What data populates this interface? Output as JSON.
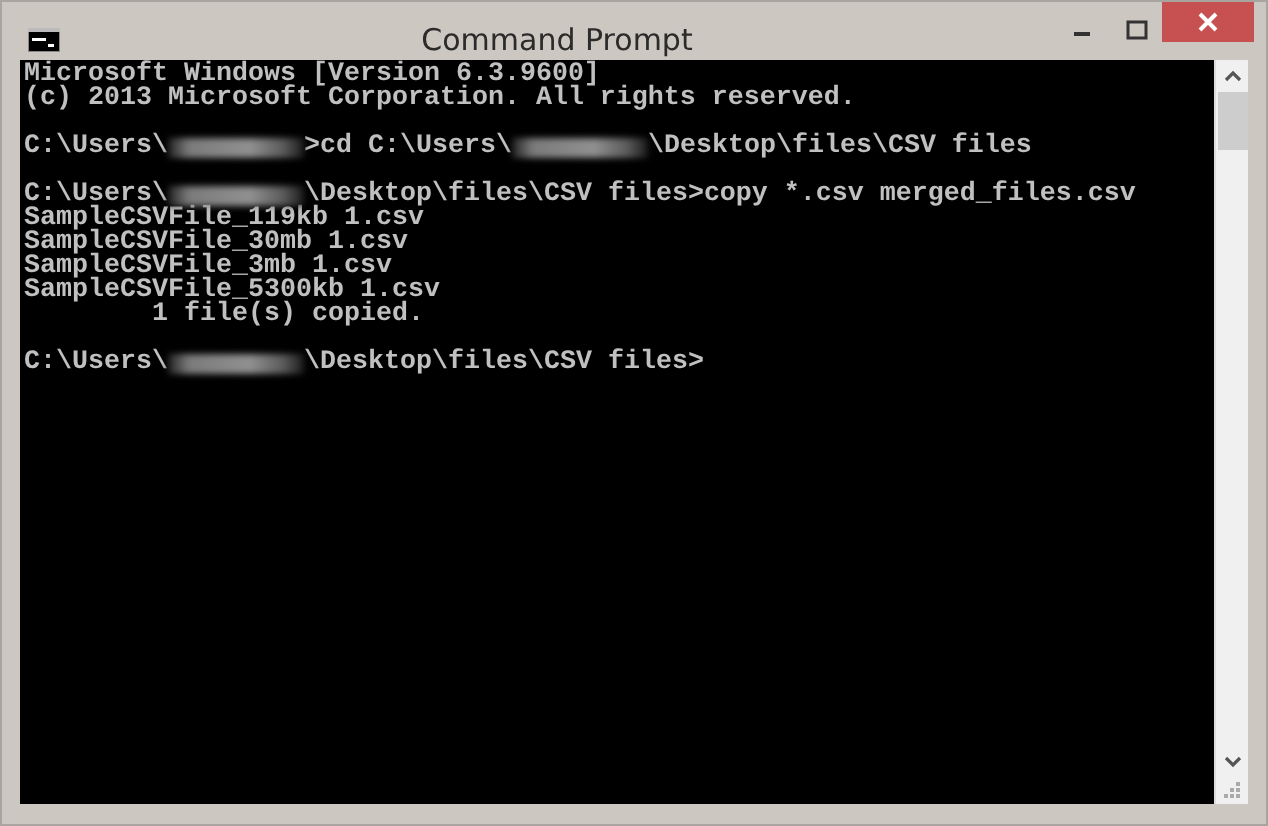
{
  "window": {
    "title": "Command Prompt"
  },
  "console": {
    "lines": [
      {
        "kind": "text",
        "segments": [
          {
            "kind": "text",
            "text": "Microsoft Windows [Version 6.3.9600]"
          }
        ]
      },
      {
        "kind": "text",
        "segments": [
          {
            "kind": "text",
            "text": "(c) 2013 Microsoft Corporation. All rights reserved."
          }
        ]
      },
      {
        "kind": "blank"
      },
      {
        "kind": "text",
        "segments": [
          {
            "kind": "text",
            "text": "C:\\Users\\"
          },
          {
            "kind": "redacted"
          },
          {
            "kind": "text",
            "text": ">cd C:\\Users\\"
          },
          {
            "kind": "redacted"
          },
          {
            "kind": "text",
            "text": "\\Desktop\\files\\CSV files"
          }
        ]
      },
      {
        "kind": "blank"
      },
      {
        "kind": "text",
        "segments": [
          {
            "kind": "text",
            "text": "C:\\Users\\"
          },
          {
            "kind": "redacted"
          },
          {
            "kind": "text",
            "text": "\\Desktop\\files\\CSV files>copy *.csv merged_files.csv"
          }
        ]
      },
      {
        "kind": "text",
        "segments": [
          {
            "kind": "text",
            "text": "SampleCSVFile_119kb 1.csv"
          }
        ]
      },
      {
        "kind": "text",
        "segments": [
          {
            "kind": "text",
            "text": "SampleCSVFile_30mb 1.csv"
          }
        ]
      },
      {
        "kind": "text",
        "segments": [
          {
            "kind": "text",
            "text": "SampleCSVFile_3mb 1.csv"
          }
        ]
      },
      {
        "kind": "text",
        "segments": [
          {
            "kind": "text",
            "text": "SampleCSVFile_5300kb 1.csv"
          }
        ]
      },
      {
        "kind": "text",
        "segments": [
          {
            "kind": "text",
            "text": "        1 file(s) copied."
          }
        ]
      },
      {
        "kind": "blank"
      },
      {
        "kind": "text",
        "segments": [
          {
            "kind": "text",
            "text": "C:\\Users\\"
          },
          {
            "kind": "redacted"
          },
          {
            "kind": "text",
            "text": "\\Desktop\\files\\CSV files>"
          }
        ]
      }
    ]
  }
}
